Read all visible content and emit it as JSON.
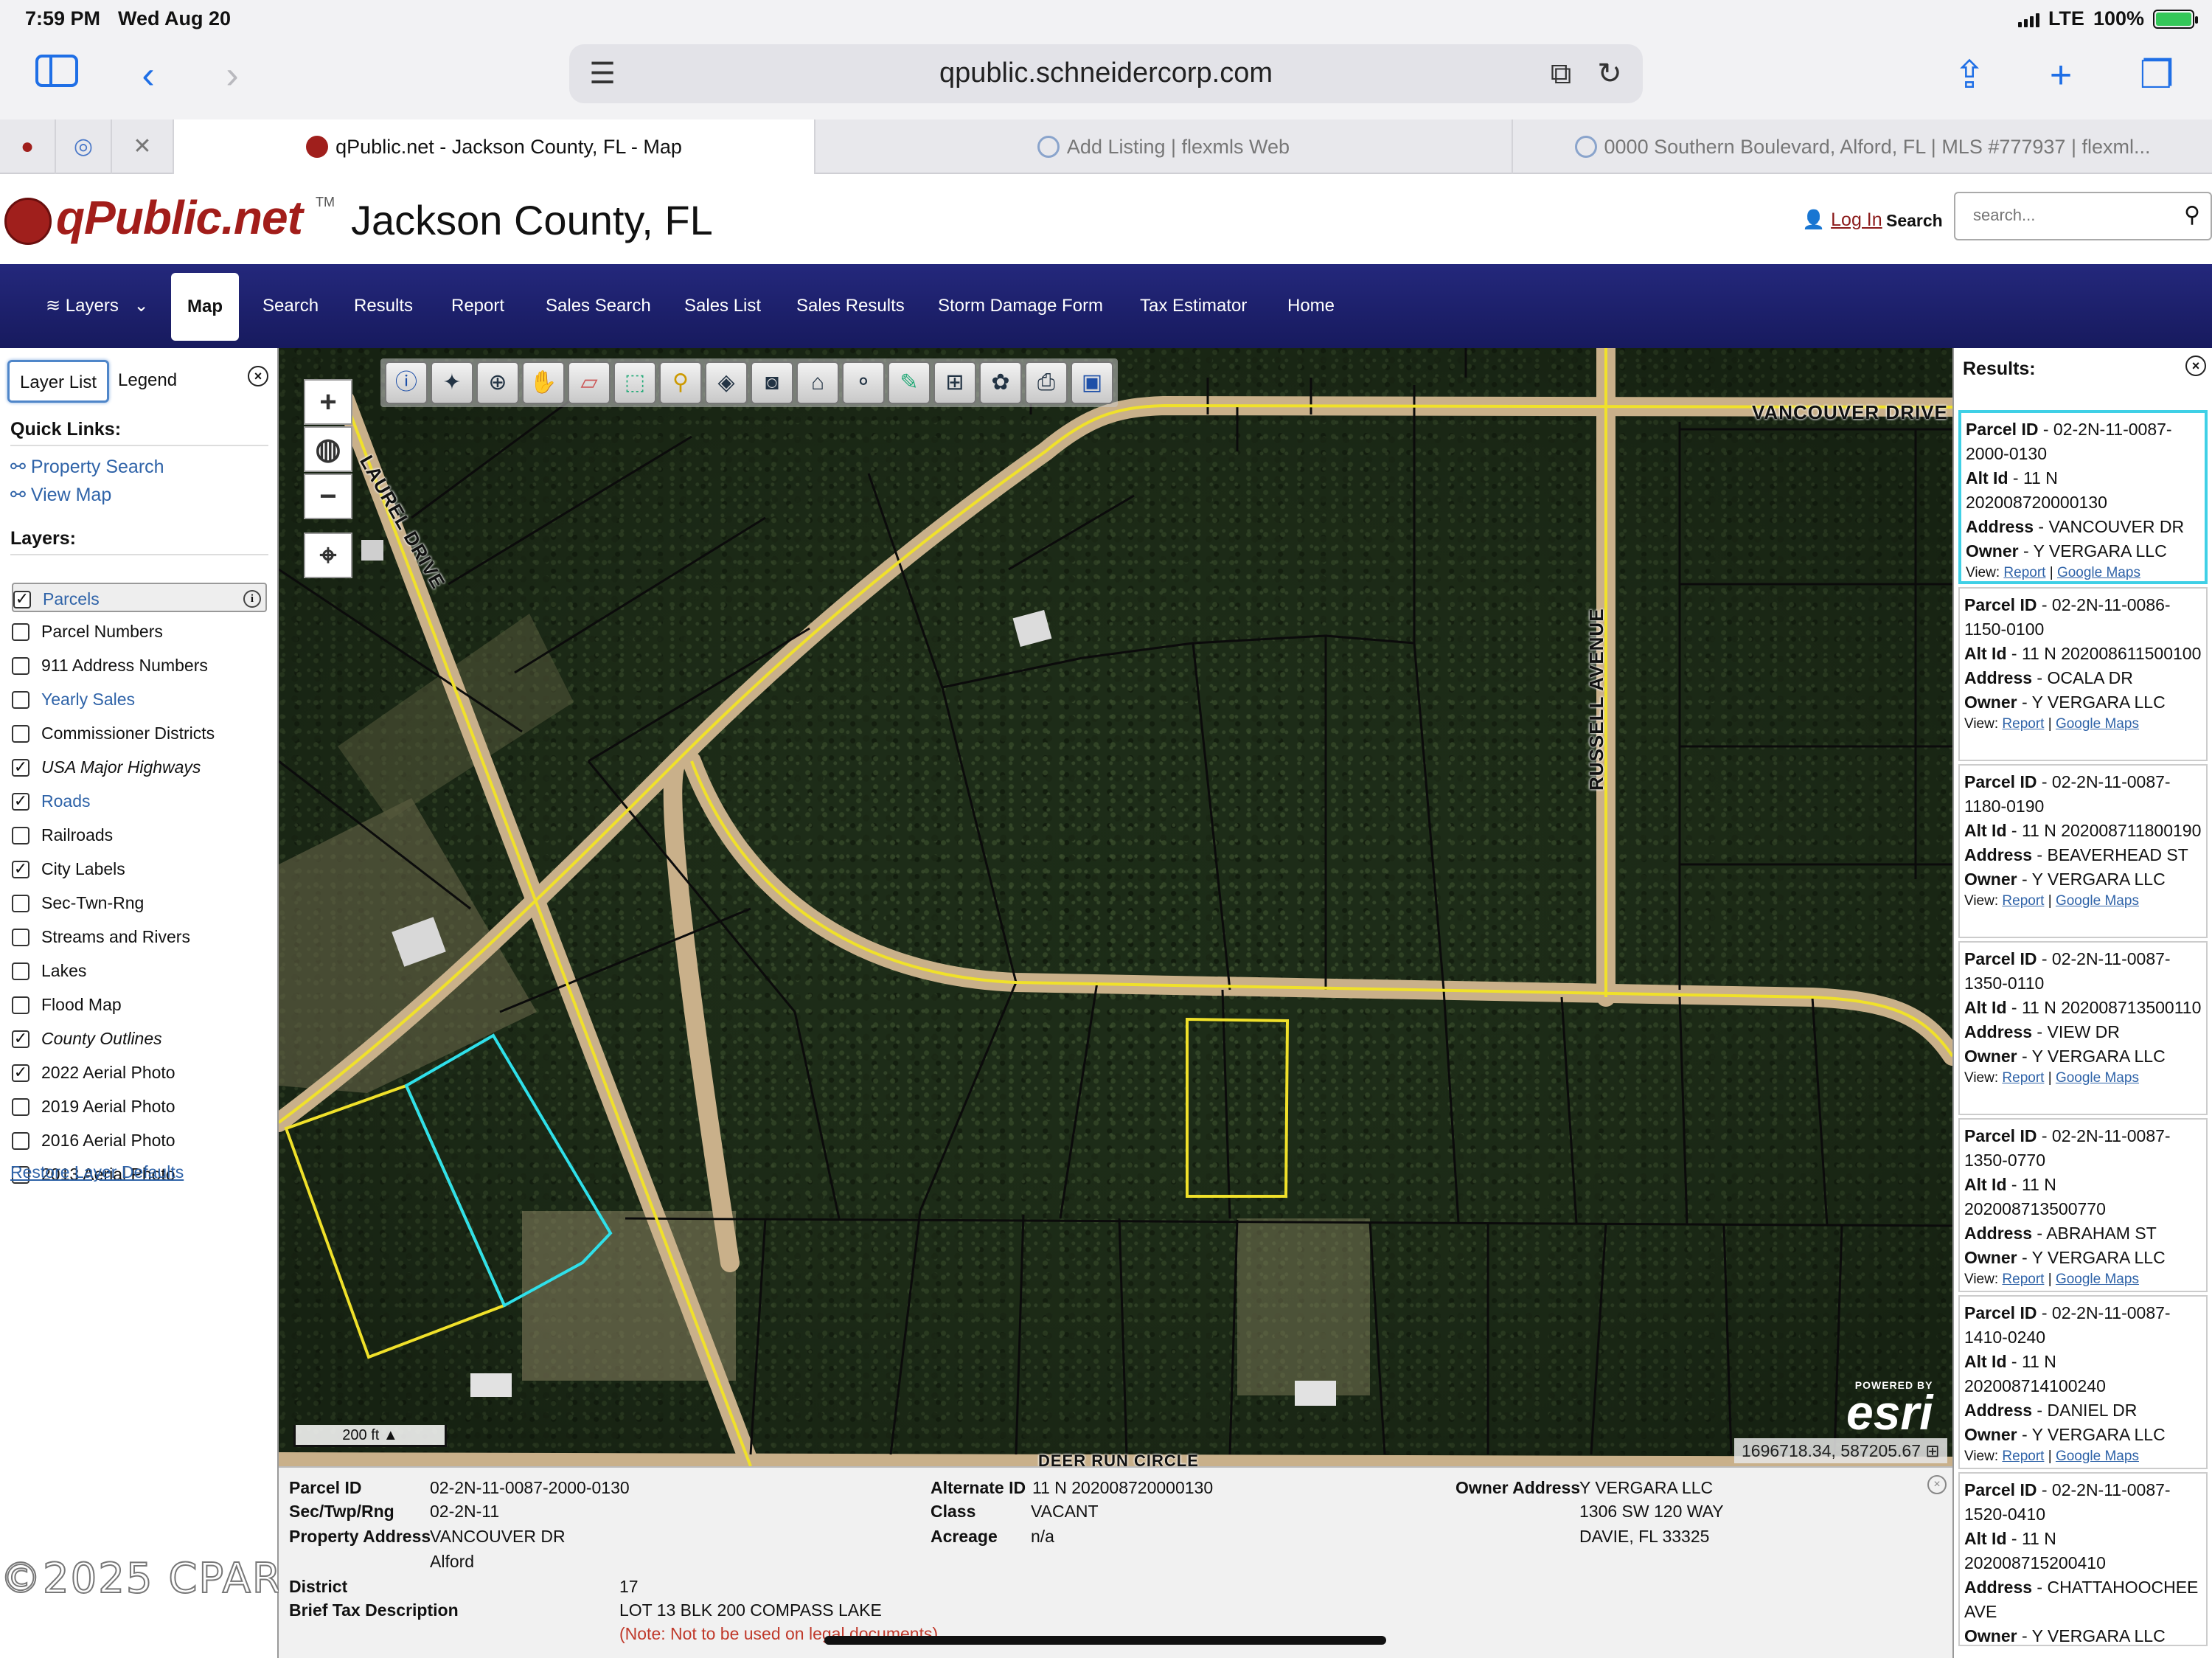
{
  "status": {
    "time": "7:59 PM",
    "date": "Wed Aug 20",
    "network": "LTE",
    "battery": "100%",
    "battery_level": 1.0
  },
  "browser": {
    "url": "qpublic.schneidercorp.com",
    "tabs": [
      {
        "title": "qPublic.net - Jackson County, FL - Map",
        "active": true
      },
      {
        "title": "Add Listing | flexmls Web",
        "active": false
      },
      {
        "title": "0000 Southern Boulevard, Alford, FL | MLS #777937 | flexml...",
        "active": false
      }
    ]
  },
  "site": {
    "logo": "qPublic.net",
    "logo_tm": "TM",
    "county": "Jackson County, FL",
    "login": "Log In",
    "search_label": "Search",
    "search_placeholder": "search..."
  },
  "nav": [
    "Layers",
    "Map",
    "Search",
    "Results",
    "Report",
    "Sales Search",
    "Sales List",
    "Sales Results",
    "Storm Damage Form",
    "Tax Estimator",
    "Home"
  ],
  "left": {
    "tabs": [
      "Layer List",
      "Legend"
    ],
    "quick_links_title": "Quick Links:",
    "quick_links": [
      "Property Search",
      "View Map"
    ],
    "layers_title": "Layers:",
    "layers": [
      {
        "label": "Parcels",
        "checked": true
      },
      {
        "label": "Parcel Numbers",
        "checked": false
      },
      {
        "label": "911 Address Numbers",
        "checked": false
      },
      {
        "label": "Yearly Sales",
        "checked": false
      },
      {
        "label": "Commissioner Districts",
        "checked": false
      },
      {
        "label": "USA Major Highways",
        "checked": true
      },
      {
        "label": "Roads",
        "checked": true
      },
      {
        "label": "Railroads",
        "checked": false
      },
      {
        "label": "City Labels",
        "checked": true
      },
      {
        "label": "Sec-Twn-Rng",
        "checked": false
      },
      {
        "label": "Streams and Rivers",
        "checked": false
      },
      {
        "label": "Lakes",
        "checked": false
      },
      {
        "label": "Flood Map",
        "checked": false
      },
      {
        "label": "County Outlines",
        "checked": true
      },
      {
        "label": "2022 Aerial Photo",
        "checked": true
      },
      {
        "label": "2019 Aerial Photo",
        "checked": false
      },
      {
        "label": "2016 Aerial Photo",
        "checked": false
      },
      {
        "label": "2013 Aerial Photo",
        "checked": false
      }
    ],
    "restore": "Restore Layer Defaults",
    "watermark": "©2025 CPAR"
  },
  "map": {
    "roads": [
      "LAUREL DRIVE",
      "VANCOUVER DRIVE",
      "RUSSELL AVENUE",
      "DEER RUN CIRCLE"
    ],
    "scale": "200 ft",
    "coords": "1696718.34, 587205.67",
    "esri_powered": "POWERED BY",
    "esri": "esri"
  },
  "info": {
    "parcel_id_label": "Parcel ID",
    "parcel_id": "02-2N-11-0087-2000-0130",
    "str_label": "Sec/Twp/Rng",
    "str": "02-2N-11",
    "addr_label": "Property Address",
    "addr": "VANCOUVER DR",
    "city": "Alford",
    "district_label": "District",
    "district": "17",
    "brief_label": "Brief Tax Description",
    "brief": "LOT 13 BLK 200 COMPASS LAKE",
    "note": "(Note: Not to be used on legal documents)",
    "alt_label": "Alternate ID",
    "alt": "11 N 202008720000130",
    "class_label": "Class",
    "class": "VACANT",
    "acreage_label": "Acreage",
    "acreage": "n/a",
    "owner_label": "Owner Address",
    "owner": "Y VERGARA LLC",
    "owner_line2": "1306 SW 120 WAY",
    "owner_line3": "DAVIE, FL 33325"
  },
  "results": {
    "title": "Results:",
    "labels": {
      "parcel": "Parcel ID",
      "alt": "Alt Id",
      "address": "Address",
      "owner": "Owner",
      "view": "View:",
      "report": "Report",
      "gmaps": "Google Maps"
    },
    "items": [
      {
        "parcel": "02-2N-11-0087-2000-0130",
        "alt": "11 N 202008720000130",
        "address": "VANCOUVER DR",
        "owner": "Y VERGARA LLC"
      },
      {
        "parcel": "02-2N-11-0086-1150-0100",
        "alt": "11 N 202008611500100",
        "address": "OCALA DR",
        "owner": "Y VERGARA LLC"
      },
      {
        "parcel": "02-2N-11-0087-1180-0190",
        "alt": "11 N 202008711800190",
        "address": "BEAVERHEAD ST",
        "owner": "Y VERGARA LLC"
      },
      {
        "parcel": "02-2N-11-0087-1350-0110",
        "alt": "11 N 202008713500110",
        "address": "VIEW DR",
        "owner": "Y VERGARA LLC"
      },
      {
        "parcel": "02-2N-11-0087-1350-0770",
        "alt": "11 N 202008713500770",
        "address": "ABRAHAM ST",
        "owner": "Y VERGARA LLC"
      },
      {
        "parcel": "02-2N-11-0087-1410-0240",
        "alt": "11 N 202008714100240",
        "address": "DANIEL DR",
        "owner": "Y VERGARA LLC"
      },
      {
        "parcel": "02-2N-11-0087-1520-0410",
        "alt": "11 N 202008715200410",
        "address": "CHATTAHOOCHEE AVE",
        "owner": "Y VERGARA LLC"
      }
    ]
  }
}
